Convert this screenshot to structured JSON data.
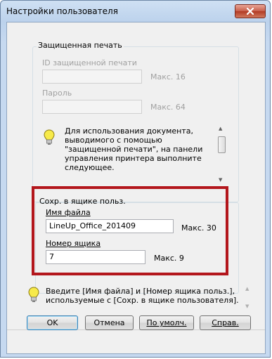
{
  "window": {
    "title": "Настройки пользователя"
  },
  "secure_print": {
    "group_title": "Защищенная печать",
    "id_label": "ID защищенной печати",
    "id_max": "Макс. 16",
    "password_label": "Пароль",
    "password_max": "Макс. 64",
    "info_text": "Для использования документа, выводимого с помощью \"защищенной печати\", на панели управления принтера выполните следующее."
  },
  "user_box": {
    "group_title": "Сохр. в ящике польз.",
    "filename_label": "Имя файла",
    "filename_value": "LineUp_Office_201409",
    "filename_max": "Макс. 30",
    "box_number_label": "Номер ящика",
    "box_number_value": "7",
    "box_number_max": "Макс. 9"
  },
  "hint": {
    "text": "Введите [Имя файла] и [Номер ящика польз.], используемые с [Сохр. в ящике пользователя]."
  },
  "buttons": {
    "ok": "OK",
    "cancel": "Отмена",
    "defaults": "По умолч.",
    "help": "Справ."
  },
  "colors": {
    "highlight": "#b3161c",
    "close_button": "#c75e4a"
  },
  "icons": {
    "info": "lightbulb-icon",
    "close": "close-icon"
  }
}
